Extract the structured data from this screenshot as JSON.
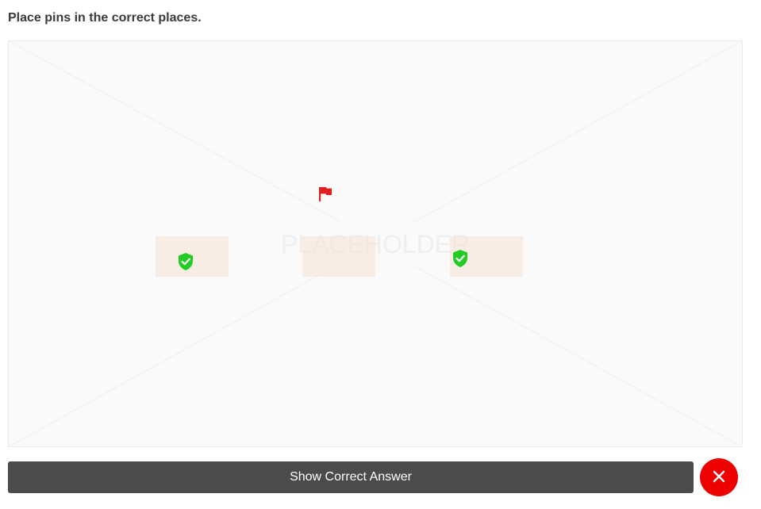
{
  "question": {
    "title": "Place pins in the correct places."
  },
  "image": {
    "placeholder_text": "PLACEHOLDER"
  },
  "drop_zones": [
    {
      "pin": "check-shield-icon",
      "status": "correct"
    },
    {
      "pin": "none",
      "status": "empty"
    },
    {
      "pin": "check-shield-icon",
      "status": "correct"
    }
  ],
  "placed_pins": [
    {
      "icon": "flag-icon",
      "status": "incorrect"
    }
  ],
  "actions": {
    "show_answer_label": "Show Correct Answer",
    "close_icon": "close-icon"
  },
  "colors": {
    "correct": "#22cc22",
    "incorrect": "#e02020",
    "button_bg": "#4b4b4b",
    "close_bg": "#ee0000",
    "drop_zone": "#f6e1d4"
  }
}
